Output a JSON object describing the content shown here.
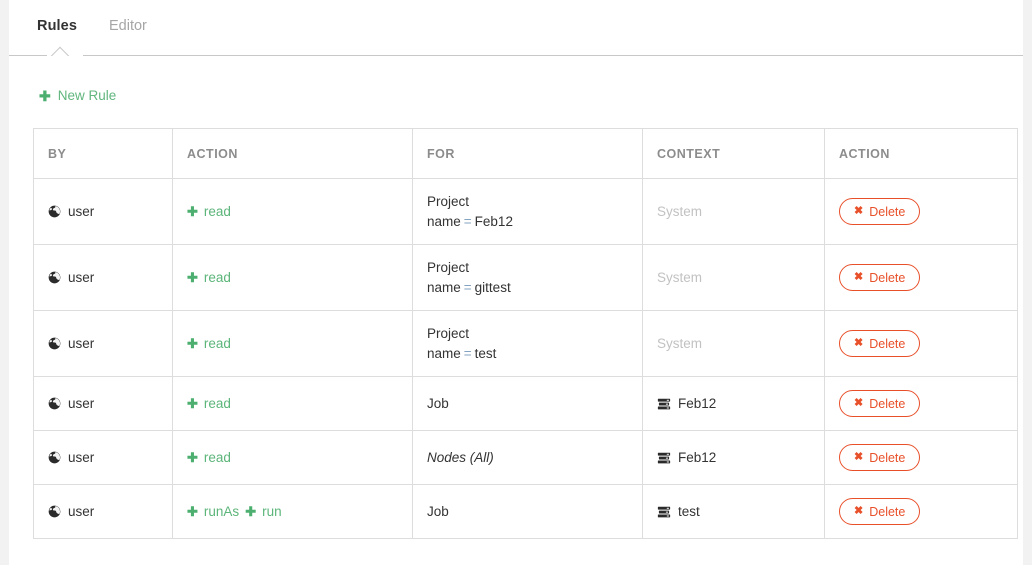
{
  "tabs": [
    {
      "label": "Rules",
      "active": true
    },
    {
      "label": "Editor",
      "active": false
    }
  ],
  "toolbar": {
    "new_rule_label": "New Rule",
    "new_rule_icon": "plus-icon"
  },
  "table": {
    "headers": [
      "BY",
      "ACTION",
      "FOR",
      "CONTEXT",
      "ACTION"
    ],
    "rows": [
      {
        "by": {
          "icon": "globe-icon",
          "label": "user"
        },
        "actions": [
          {
            "icon": "plus-icon",
            "label": "read"
          }
        ],
        "for": {
          "type": "kv",
          "title": "Project",
          "key": "name",
          "op": "=",
          "value": "Feb12"
        },
        "context": {
          "icon": null,
          "label": "System",
          "muted": true
        },
        "delete": {
          "icon": "times-icon",
          "label": "Delete"
        }
      },
      {
        "by": {
          "icon": "globe-icon",
          "label": "user"
        },
        "actions": [
          {
            "icon": "plus-icon",
            "label": "read"
          }
        ],
        "for": {
          "type": "kv",
          "title": "Project",
          "key": "name",
          "op": "=",
          "value": "gittest"
        },
        "context": {
          "icon": null,
          "label": "System",
          "muted": true
        },
        "delete": {
          "icon": "times-icon",
          "label": "Delete"
        }
      },
      {
        "by": {
          "icon": "globe-icon",
          "label": "user"
        },
        "actions": [
          {
            "icon": "plus-icon",
            "label": "read"
          }
        ],
        "for": {
          "type": "kv",
          "title": "Project",
          "key": "name",
          "op": "=",
          "value": "test"
        },
        "context": {
          "icon": null,
          "label": "System",
          "muted": true
        },
        "delete": {
          "icon": "times-icon",
          "label": "Delete"
        }
      },
      {
        "by": {
          "icon": "globe-icon",
          "label": "user"
        },
        "actions": [
          {
            "icon": "plus-icon",
            "label": "read"
          }
        ],
        "for": {
          "type": "plain",
          "title": "Job"
        },
        "context": {
          "icon": "server-icon",
          "label": "Feb12",
          "muted": false
        },
        "delete": {
          "icon": "times-icon",
          "label": "Delete"
        }
      },
      {
        "by": {
          "icon": "globe-icon",
          "label": "user"
        },
        "actions": [
          {
            "icon": "plus-icon",
            "label": "read"
          }
        ],
        "for": {
          "type": "italic",
          "title": "Nodes (All)"
        },
        "context": {
          "icon": "server-icon",
          "label": "Feb12",
          "muted": false
        },
        "delete": {
          "icon": "times-icon",
          "label": "Delete"
        }
      },
      {
        "by": {
          "icon": "globe-icon",
          "label": "user"
        },
        "actions": [
          {
            "icon": "plus-icon",
            "label": "runAs"
          },
          {
            "icon": "plus-icon",
            "label": "run"
          }
        ],
        "for": {
          "type": "plain",
          "title": "Job"
        },
        "context": {
          "icon": "server-icon",
          "label": "test",
          "muted": false
        },
        "delete": {
          "icon": "times-icon",
          "label": "Delete"
        }
      }
    ]
  },
  "colors": {
    "accent_green": "#5cb57a",
    "danger": "#e8502a",
    "header_text": "#8c8c8c",
    "muted_text": "#c2c2c2",
    "operator": "#84a3c0",
    "border": "#dddddd"
  }
}
